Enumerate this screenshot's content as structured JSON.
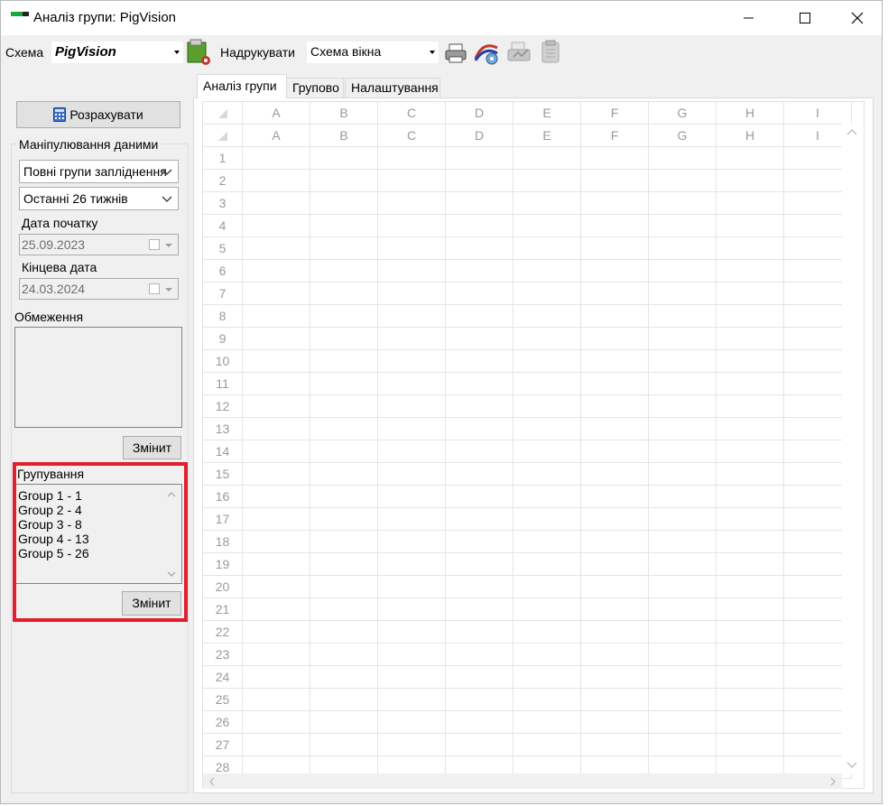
{
  "window": {
    "title": "Аналіз групи: PigVision"
  },
  "toolbar": {
    "scheme_label": "Схема",
    "scheme_value": "PigVision",
    "print_label": "Надрукувати",
    "print_value": "Схема вікна"
  },
  "left": {
    "calculate_label": "Розрахувати",
    "data_section_label": "Маніпулювання даними",
    "groups_combo": "Повні групи запліднення",
    "period_combo": "Останні 26 тижнів",
    "start_date_label": "Дата початку",
    "start_date_value": "25.09.2023",
    "end_date_label": "Кінцева дата",
    "end_date_value": "24.03.2024",
    "limits_label": "Обмеження",
    "limits_change_label": "Змінит",
    "grouping_label": "Групування",
    "grouping_items": [
      "Group 1 - 1",
      "Group 2 - 4",
      "Group 3 - 8",
      "Group 4 - 13",
      "Group 5 - 26"
    ],
    "grouping_change_label": "Змінит"
  },
  "tabs": [
    {
      "label": "Аналіз групи"
    },
    {
      "label": "Групово"
    },
    {
      "label": "Налаштування"
    }
  ],
  "grid": {
    "columns": [
      "A",
      "B",
      "C",
      "D",
      "E",
      "F",
      "G",
      "H",
      "I"
    ],
    "rows": [
      "1",
      "2",
      "3",
      "4",
      "5",
      "6",
      "7",
      "8",
      "9",
      "10",
      "11",
      "12",
      "13",
      "14",
      "15",
      "16",
      "17",
      "18",
      "19",
      "20",
      "21",
      "22",
      "23",
      "24",
      "25",
      "26",
      "27",
      "28"
    ]
  }
}
